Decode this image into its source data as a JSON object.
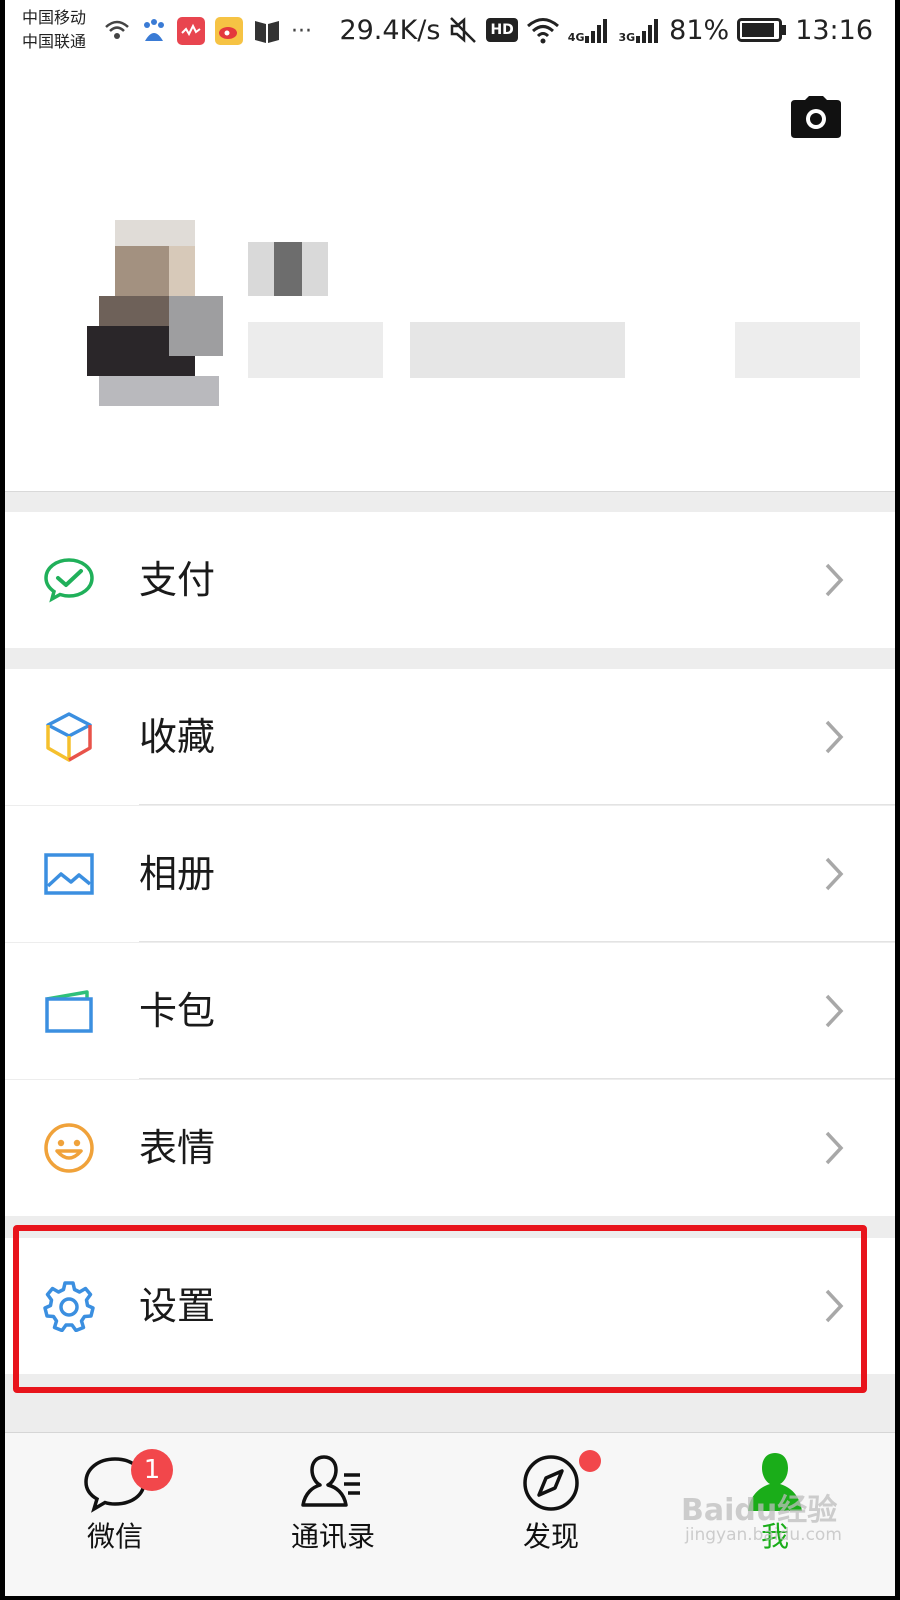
{
  "status_bar": {
    "carrier_1": "中国移动",
    "carrier_2": "中国联通",
    "overflow": "···",
    "net_speed": "29.4K/s",
    "hd": "HD",
    "sim1_type": "4G",
    "sim2_type": "3G",
    "battery": "81%",
    "time": "13:16"
  },
  "menu": {
    "pay": "支付",
    "favorites": "收藏",
    "album": "相册",
    "cards": "卡包",
    "stickers": "表情",
    "settings": "设置"
  },
  "tabs": {
    "chats": "微信",
    "chats_badge": "1",
    "contacts": "通讯录",
    "discover": "发现",
    "me": "我"
  },
  "watermark": {
    "brand": "Baidu经验",
    "url": "jingyan.baidu.com"
  },
  "colors": {
    "accent_green": "#1aad19",
    "highlight_red": "#e8141c",
    "badge_red": "#f2474b"
  }
}
